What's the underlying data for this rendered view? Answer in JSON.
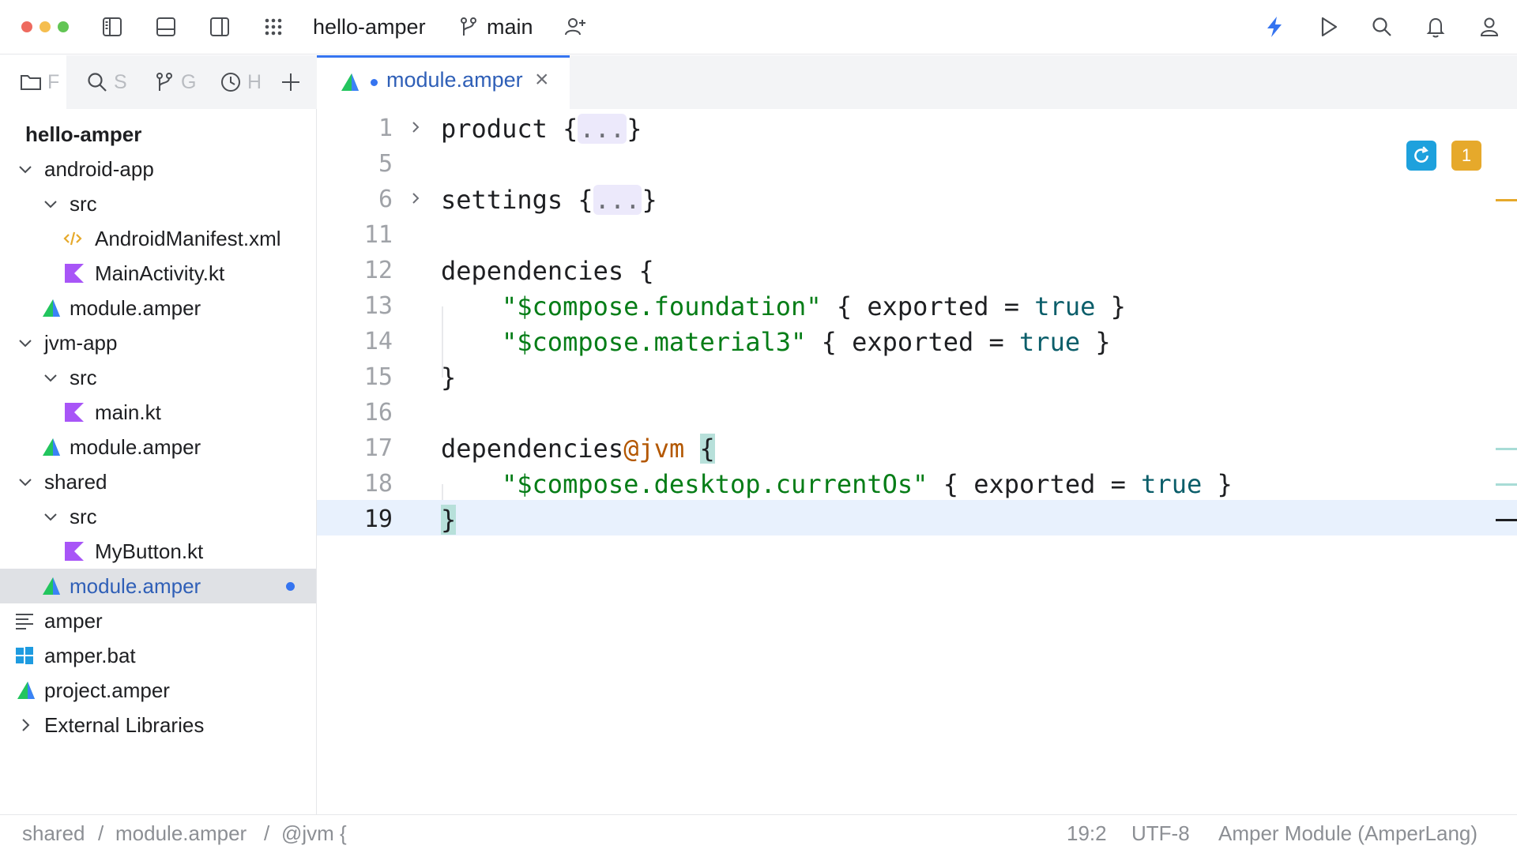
{
  "toolbar": {
    "project_name": "hello-amper",
    "branch_name": "main",
    "icons": [
      "left-panel-icon",
      "bottom-panel-icon",
      "right-panel-icon",
      "app-grid-icon",
      "branch-icon",
      "add-user-icon",
      "lightning-icon",
      "run-icon",
      "search-icon",
      "bell-icon",
      "profile-icon"
    ],
    "accent_color": "#3574f0"
  },
  "left_tabs": [
    {
      "icon": "folder-icon",
      "label": "F"
    },
    {
      "icon": "search-icon",
      "label": "S"
    },
    {
      "icon": "branch-icon",
      "label": "G"
    },
    {
      "icon": "clock-icon",
      "label": "H"
    },
    {
      "icon": "plus-icon",
      "label": ""
    }
  ],
  "project_tree": {
    "root": "hello-amper",
    "items": [
      {
        "label": "android-app",
        "icon": "chevron-down-icon"
      },
      {
        "label": "src",
        "icon": "chevron-down-icon"
      },
      {
        "label": "AndroidManifest.xml",
        "icon": "xml-file-icon"
      },
      {
        "label": "MainActivity.kt",
        "icon": "kotlin-file-icon"
      },
      {
        "label": "module.amper",
        "icon": "amper-file-icon"
      },
      {
        "label": "jvm-app",
        "icon": "chevron-down-icon"
      },
      {
        "label": "src",
        "icon": "chevron-down-icon"
      },
      {
        "label": "main.kt",
        "icon": "kotlin-file-icon"
      },
      {
        "label": "module.amper",
        "icon": "amper-file-icon"
      },
      {
        "label": "shared",
        "icon": "chevron-down-icon"
      },
      {
        "label": "src",
        "icon": "chevron-down-icon"
      },
      {
        "label": "MyButton.kt",
        "icon": "kotlin-file-icon"
      },
      {
        "label": "module.amper",
        "icon": "amper-file-icon",
        "selected": true,
        "modified": true
      },
      {
        "label": "amper",
        "icon": "text-file-icon"
      },
      {
        "label": "amper.bat",
        "icon": "windows-file-icon"
      },
      {
        "label": "project.amper",
        "icon": "amper-file-icon"
      },
      {
        "label": "External Libraries",
        "icon": "chevron-right-icon"
      }
    ]
  },
  "editor_tab": {
    "label": "module.amper",
    "close": "×",
    "modified": true
  },
  "editor": {
    "lines": [
      {
        "num": "1"
      },
      {
        "num": "5"
      },
      {
        "num": "6"
      },
      {
        "num": "11"
      },
      {
        "num": "12"
      },
      {
        "num": "13"
      },
      {
        "num": "14"
      },
      {
        "num": "15"
      },
      {
        "num": "16"
      },
      {
        "num": "17"
      },
      {
        "num": "18"
      },
      {
        "num": "19"
      }
    ],
    "tokens": {
      "product": "product ",
      "settings": "settings ",
      "open_brace": "{",
      "close_brace": "}",
      "ellipsis": "...",
      "dependencies": "dependencies ",
      "dependencies_jvm": "dependencies",
      "jvm_qualifier": "@jvm",
      "dep1": "\"$compose.foundation\"",
      "dep2": "\"$compose.material3\"",
      "dep3": "\"$compose.desktop.currentOs\"",
      "exported_open": " { exported = ",
      "true": "true",
      "exported_close": " }"
    },
    "current_line": "19",
    "warning_count": "1"
  },
  "status_bar": {
    "breadcrumb": [
      "shared",
      "module.amper",
      "@jvm {"
    ],
    "separator": "/",
    "position": "19:2",
    "encoding": "UTF-8",
    "language": "Amper Module (AmperLang)"
  }
}
